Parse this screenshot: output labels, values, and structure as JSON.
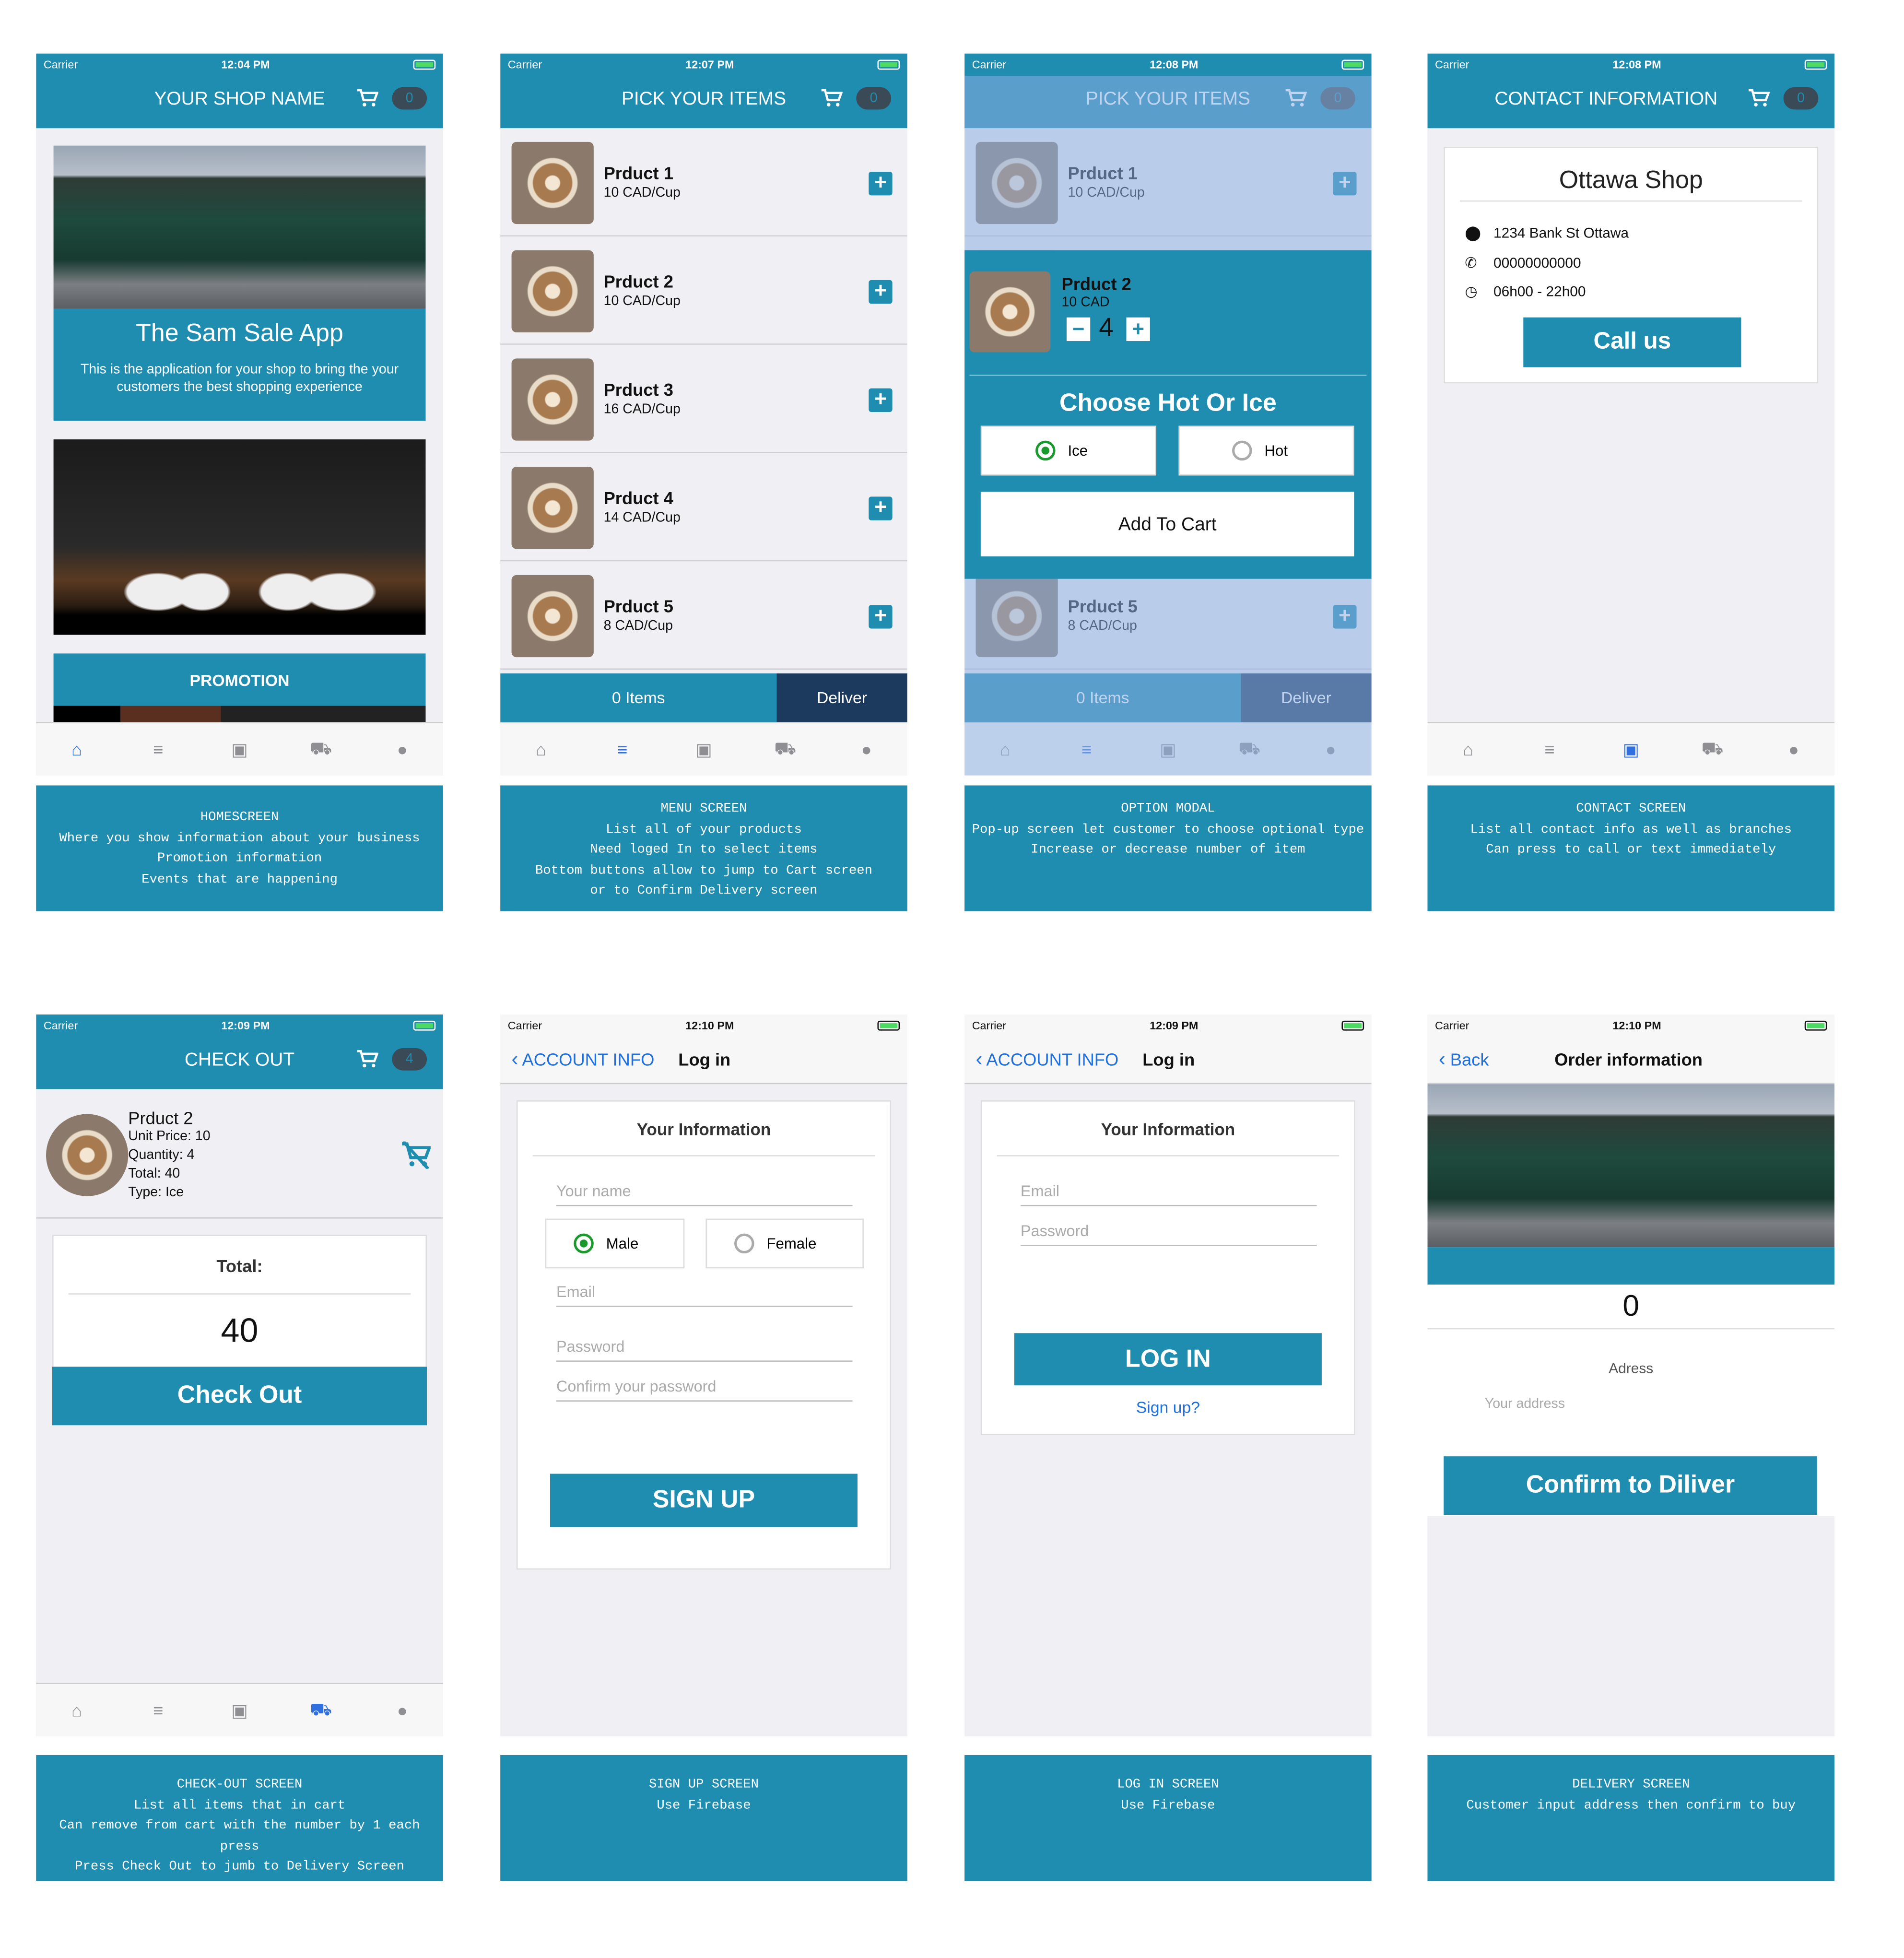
{
  "status": {
    "carrier": "Carrier",
    "times": [
      "12:04 PM",
      "12:07 PM",
      "12:08 PM",
      "12:08 PM",
      "12:09 PM",
      "12:10 PM",
      "12:09 PM",
      "12:10 PM"
    ]
  },
  "home": {
    "title": "YOUR SHOP NAME",
    "badge": "0",
    "app_name": "The Sam Sale App",
    "description": "This is the application for your shop to bring the your customers the best shopping experience",
    "promotion": "PROMOTION"
  },
  "menu": {
    "title": "PICK YOUR ITEMS",
    "badge": "0",
    "items": [
      {
        "name": "Prduct 1",
        "price": "10 CAD/Cup"
      },
      {
        "name": "Prduct 2",
        "price": "10 CAD/Cup"
      },
      {
        "name": "Prduct 3",
        "price": "16 CAD/Cup"
      },
      {
        "name": "Prduct 4",
        "price": "14 CAD/Cup"
      },
      {
        "name": "Prduct 5",
        "price": "8 CAD/Cup"
      }
    ],
    "items_count": "0 Items",
    "deliver": "Deliver"
  },
  "modal": {
    "product": "Prduct 2",
    "price": "10 CAD",
    "quantity": "4",
    "minus": "−",
    "plus": "+",
    "heading": "Choose Hot Or Ice",
    "options": [
      "Ice",
      "Hot"
    ],
    "selected": "Ice",
    "add_to_cart": "Add To Cart"
  },
  "contact": {
    "title": "CONTACT INFORMATION",
    "badge": "0",
    "shop": "Ottawa Shop",
    "address": "1234 Bank St Ottawa",
    "phone": "00000000000",
    "hours": "06h00 - 22h00",
    "call": "Call us"
  },
  "checkout": {
    "title": "CHECK OUT",
    "badge": "4",
    "product": "Prduct 2",
    "unit_price": "Unit Price: 10",
    "quantity": "Quantity: 4",
    "total_line": "Total: 40",
    "type": "Type: Ice",
    "total_label": "Total:",
    "total": "40",
    "button": "Check Out"
  },
  "signup": {
    "back": "ACCOUNT INFO",
    "nav_title": "Log in",
    "card_title": "Your Information",
    "name_ph": "Your name",
    "male": "Male",
    "female": "Female",
    "email_ph": "Email",
    "password_ph": "Password",
    "confirm_ph": "Confirm your password",
    "button": "SIGN UP"
  },
  "login": {
    "back": "ACCOUNT INFO",
    "nav_title": "Log in",
    "card_title": "Your Information",
    "email_ph": "Email",
    "password_ph": "Password",
    "button": "LOG IN",
    "signup_link": "Sign up?"
  },
  "delivery": {
    "back": "Back",
    "nav_title": "Order information",
    "total": "0",
    "address_label": "Adress",
    "address_ph": "Your address",
    "button": "Confirm to Diliver"
  },
  "captions": [
    "HOMESCREEN\nWhere you show information about your business\nPromotion information\nEvents that are happening",
    "MENU SCREEN\nList all of your products\nNeed loged In to select items\nBottom buttons allow to jump to Cart screen\nor to Confirm Delivery screen",
    "OPTION MODAL\nPop-up screen let customer to choose optional type\nIncrease or decrease number of item",
    "CONTACT SCREEN\nList all contact info as well as branches\nCan press to call or text immediately",
    "CHECK-OUT SCREEN\nList all items that in cart\nCan remove from cart with the number by 1 each press\nPress Check Out to jumb to Delivery Screen",
    "SIGN UP SCREEN\nUse Firebase",
    "LOG IN SCREEN\nUse Firebase",
    "DELIVERY SCREEN\nCustomer input address then confirm to buy"
  ],
  "colors": {
    "teal": "#1e8db0",
    "navy": "#1c3a5e",
    "tab_active": "#2f6fe0"
  }
}
